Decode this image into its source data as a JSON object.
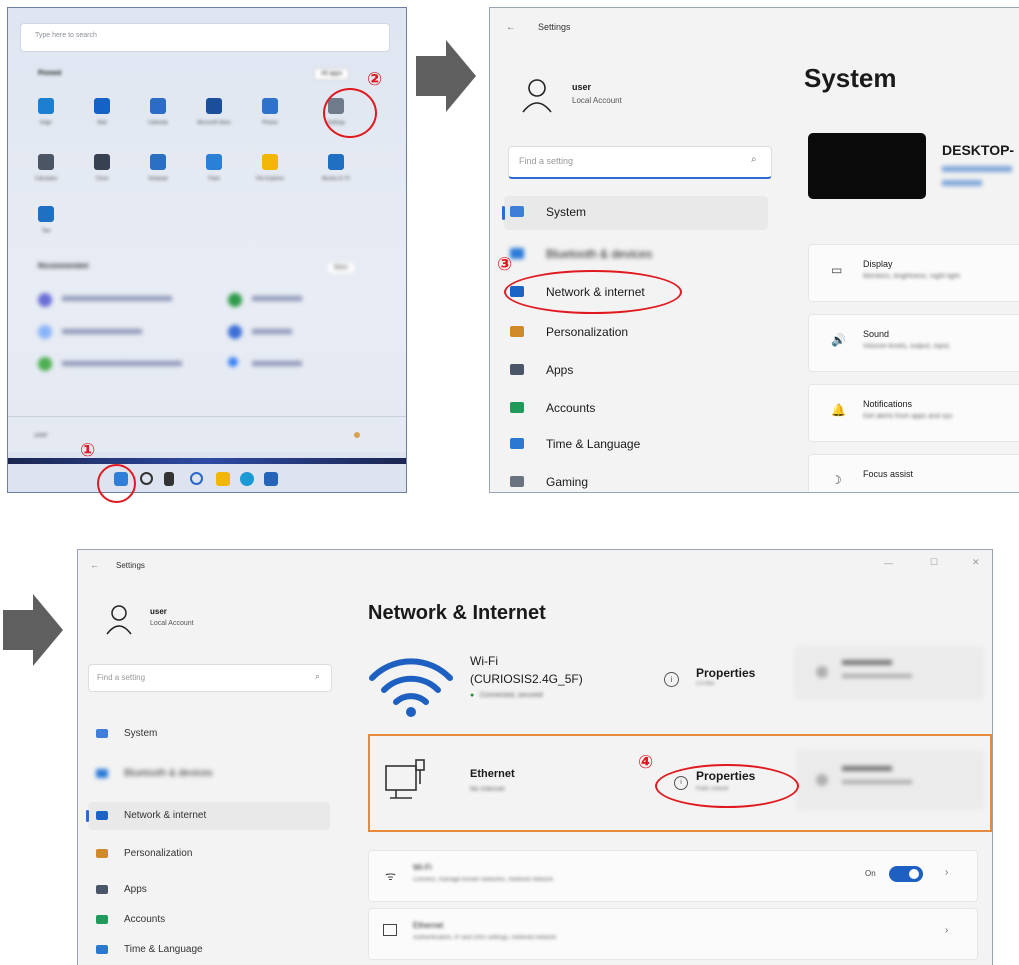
{
  "start_menu": {
    "search_placeholder": "Type here to search",
    "pinned_label": "Pinned",
    "all_apps_label": "All apps",
    "recommended_label": "Recommended",
    "more_label": "More",
    "user_label": "user",
    "pinned_apps": [
      {
        "label": "Edge",
        "color": "#1e7fd0"
      },
      {
        "label": "Mail",
        "color": "#1662c4"
      },
      {
        "label": "Calendar",
        "color": "#2b6cc4"
      },
      {
        "label": "Microsoft Store",
        "color": "#1b4f9a"
      },
      {
        "label": "Photos",
        "color": "#2f72c9"
      },
      {
        "label": "Settings",
        "color": "#6f7b8a"
      },
      {
        "label": "Calculator",
        "color": "#4b5563"
      },
      {
        "label": "Clock",
        "color": "#374151"
      },
      {
        "label": "Notepad",
        "color": "#2a6fc0"
      },
      {
        "label": "Paint",
        "color": "#2b7fd4"
      },
      {
        "label": "File Explorer",
        "color": "#f2b705"
      },
      {
        "label": "Movies & TV",
        "color": "#1f6fc2"
      },
      {
        "label": "Tips",
        "color": "#1f6fc2"
      }
    ]
  },
  "settings_system": {
    "title": "Settings",
    "user_name": "user",
    "account_type": "Local Account",
    "search_placeholder": "Find a setting",
    "page_title": "System",
    "device_name": "DESKTOP-",
    "nav": [
      {
        "label": "System",
        "color": "#3f7fd9"
      },
      {
        "label": "Bluetooth & devices",
        "color": "#2a7ad8"
      },
      {
        "label": "Network & internet",
        "color": "#1b64c5"
      },
      {
        "label": "Personalization",
        "color": "#d08a2a"
      },
      {
        "label": "Apps",
        "color": "#4a5568"
      },
      {
        "label": "Accounts",
        "color": "#1f9a5a"
      },
      {
        "label": "Time & Language",
        "color": "#2a78d0"
      },
      {
        "label": "Gaming",
        "color": "#6b7280"
      }
    ],
    "cards": [
      {
        "title": "Display",
        "desc": "Monitors, brightness, night light",
        "icon": "▭"
      },
      {
        "title": "Sound",
        "desc": "Volume levels, output, input,",
        "icon": "🔊"
      },
      {
        "title": "Notifications",
        "desc": "Get alerts from apps and sys",
        "icon": "🔔"
      },
      {
        "title": "Focus assist",
        "desc": "",
        "icon": "☽"
      }
    ]
  },
  "settings_network": {
    "title": "Settings",
    "user_name": "user",
    "account_type": "Local Account",
    "search_placeholder": "Find a setting",
    "page_title": "Network & Internet",
    "window_controls": [
      "—",
      "☐",
      "✕"
    ],
    "nav": [
      {
        "label": "System",
        "color": "#3f7fd9"
      },
      {
        "label": "Bluetooth & devices",
        "color": "#2a7ad8"
      },
      {
        "label": "Network & internet",
        "color": "#1b64c5"
      },
      {
        "label": "Personalization",
        "color": "#d08a2a"
      },
      {
        "label": "Apps",
        "color": "#4a5568"
      },
      {
        "label": "Accounts",
        "color": "#1f9a5a"
      },
      {
        "label": "Time & Language",
        "color": "#2a78d0"
      }
    ],
    "wifi": {
      "name": "Wi-Fi",
      "ssid": "(CURIOSIS2.4G_5F)",
      "status": "Connected, secured",
      "properties": "Properties",
      "properties_sub": "2.4 GHz"
    },
    "ethernet": {
      "name": "Ethernet",
      "status": "No Internet",
      "properties": "Properties",
      "properties_sub": "Public network"
    },
    "rows": [
      {
        "title": "Wi-Fi",
        "desc": "Connect, manage known networks, metered network",
        "state": "On"
      },
      {
        "title": "Ethernet",
        "desc": "Authentication, IP and DNS settings, metered network",
        "state": ""
      }
    ]
  },
  "annotations": {
    "steps": [
      "①",
      "②",
      "③",
      "④"
    ],
    "accent": "#e0191f",
    "highlight_border": "#e88a3c"
  }
}
